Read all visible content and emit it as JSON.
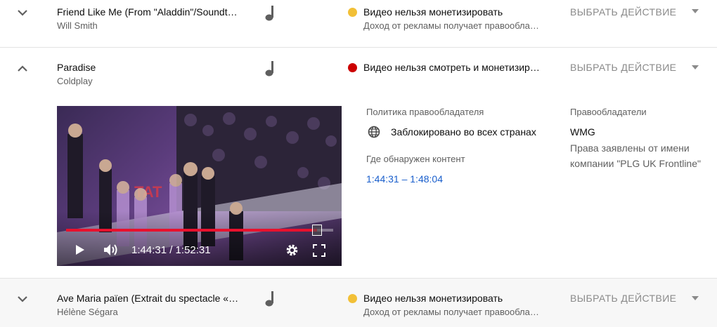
{
  "rows": [
    {
      "title": "Friend Like Me (From \"Aladdin\"/Soundt…",
      "artist": "Will Smith",
      "status": "Видео нельзя монетизировать",
      "status_sub": "Доход от рекламы получает правообла…",
      "status_color": "#f2c037",
      "action": "ВЫБРАТЬ ДЕЙСТВИЕ"
    },
    {
      "title": "Paradise",
      "artist": "Coldplay",
      "status": "Видео нельзя смотреть и монетизир…",
      "status_color": "#cc0000",
      "action": "ВЫБРАТЬ ДЕЙСТВИЕ"
    },
    {
      "title": "Ave Maria païen (Extrait du spectacle «…",
      "artist": "Hélène Ségara",
      "status": "Видео нельзя монетизировать",
      "status_sub": "Доход от рекламы получает правообла…",
      "status_color": "#f2c037",
      "action": "ВЫБРАТЬ ДЕЙСТВИЕ"
    }
  ],
  "details": {
    "policy_label": "Политика правообладателя",
    "policy_value": "Заблокировано во всех странах",
    "found_label": "Где обнаружен контент",
    "found_range": "1:44:31 – 1:48:04",
    "owners_label": "Правообладатели",
    "owner": "WMG",
    "owner_note_1": "Права заявлены от имени",
    "owner_note_2": "компании \"PLG UK Frontline\""
  },
  "player": {
    "time": "1:44:31 / 1:52:31",
    "progress": 0.94,
    "overlay_text": "TAT"
  },
  "icons": {
    "expand": "chevron-down-icon",
    "collapse": "chevron-up-icon",
    "music": "music-note-icon",
    "globe": "globe-icon",
    "play": "play-icon",
    "volume": "volume-icon",
    "settings": "gear-icon",
    "fullscreen": "fullscreen-icon"
  }
}
